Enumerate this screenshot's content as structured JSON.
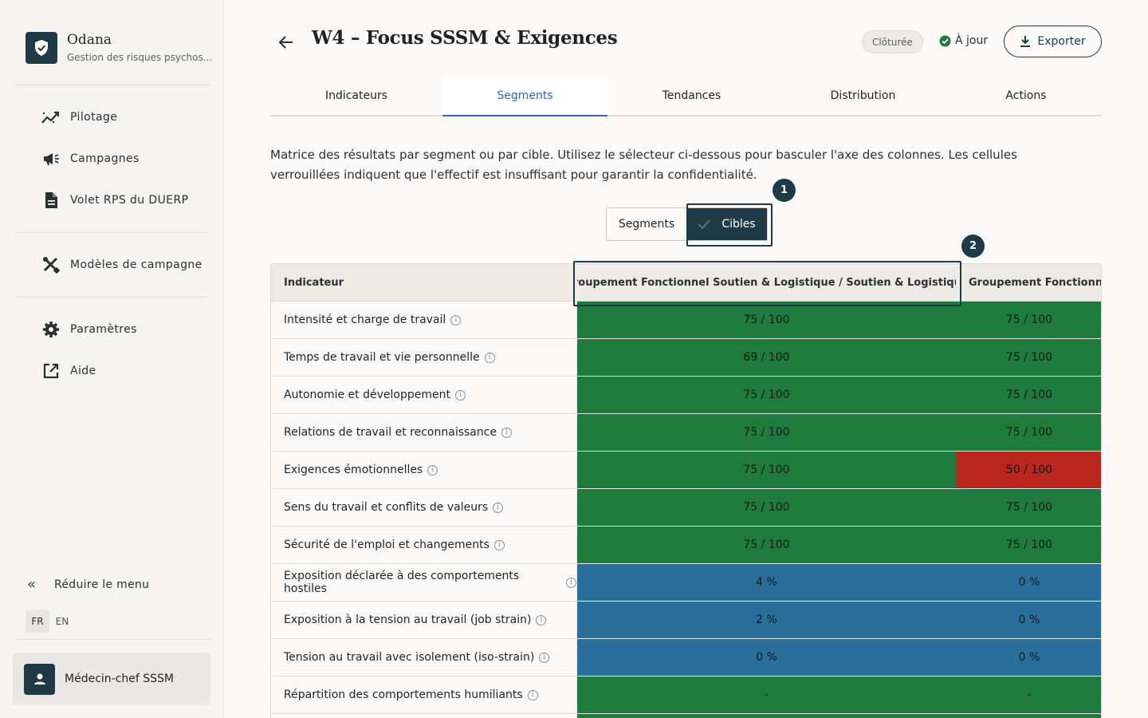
{
  "app": {
    "name": "Odana",
    "subtitle": "Gestion des risques psychos..."
  },
  "sidebar": {
    "items": [
      {
        "label": "Pilotage",
        "icon": "chart-trend-icon"
      },
      {
        "label": "Campagnes",
        "icon": "megaphone-icon"
      },
      {
        "label": "Volet RPS du DUERP",
        "icon": "document-icon"
      },
      {
        "label": "Modèles de campagne",
        "icon": "tools-icon"
      },
      {
        "label": "Paramètres",
        "icon": "gear-icon"
      },
      {
        "label": "Aide",
        "icon": "external-link-icon"
      }
    ],
    "collapse_label": "Réduire le menu",
    "languages": [
      "FR",
      "EN"
    ],
    "active_language": "FR",
    "user": "Médecin-chef SSSM"
  },
  "header": {
    "title": "W4 – Focus SSSM & Exigences",
    "badge": "Clôturée",
    "status": "À jour",
    "export_label": "Exporter"
  },
  "tabs": [
    "Indicateurs",
    "Segments",
    "Tendances",
    "Distribution",
    "Actions"
  ],
  "active_tab": "Segments",
  "intro": "Matrice des résultats par segment ou par cible. Utilisez le sélecteur ci-dessous pour basculer l'axe des colonnes. Les cellules verrouillées indiquent que l'effectif est insuffisant pour garantir la confidentialité.",
  "toggle": {
    "options": [
      "Segments",
      "Cibles"
    ],
    "selected": "Cibles"
  },
  "markers": [
    "1",
    "2"
  ],
  "table": {
    "headers": [
      "Indicateur",
      "Groupement Fonctionnel Soutien & Logistique / Soutien & Logistique",
      "Groupement Fonctionnel Soutien & Logistique"
    ],
    "rows": [
      {
        "label": "Intensité et charge de travail",
        "v1": "75 / 100",
        "v2": "75 / 100",
        "s1": "good",
        "s2": "good"
      },
      {
        "label": "Temps de travail et vie personnelle",
        "v1": "69 / 100",
        "v2": "75 / 100",
        "s1": "good",
        "s2": "good"
      },
      {
        "label": "Autonomie et développement",
        "v1": "75 / 100",
        "v2": "75 / 100",
        "s1": "good",
        "s2": "good"
      },
      {
        "label": "Relations de travail et reconnaissance",
        "v1": "75 / 100",
        "v2": "75 / 100",
        "s1": "good",
        "s2": "good"
      },
      {
        "label": "Exigences émotionnelles",
        "v1": "75 / 100",
        "v2": "50 / 100",
        "s1": "good",
        "s2": "bad"
      },
      {
        "label": "Sens du travail et conflits de valeurs",
        "v1": "75 / 100",
        "v2": "75 / 100",
        "s1": "good",
        "s2": "good"
      },
      {
        "label": "Sécurité de l'emploi et changements",
        "v1": "75 / 100",
        "v2": "75 / 100",
        "s1": "good",
        "s2": "good"
      },
      {
        "label": "Exposition déclarée à des comportements hostiles",
        "v1": "4 %",
        "v2": "0 %",
        "s1": "rate",
        "s2": "rate"
      },
      {
        "label": "Exposition à la tension au travail (job strain)",
        "v1": "2 %",
        "v2": "0 %",
        "s1": "rate",
        "s2": "rate"
      },
      {
        "label": "Tension au travail avec isolement (iso-strain)",
        "v1": "0 %",
        "v2": "0 %",
        "s1": "rate",
        "s2": "rate"
      },
      {
        "label": "Répartition des comportements humiliants",
        "v1": "-",
        "v2": "-",
        "s1": "good",
        "s2": "good"
      },
      {
        "label": "",
        "v1": "",
        "v2": "",
        "s1": "good",
        "s2": "good"
      }
    ]
  },
  "colors": {
    "good": "#1f7a3d",
    "bad": "#b8261e",
    "rate": "#2a6f9b",
    "accent": "#2867c9",
    "brand": "#1f3a47"
  }
}
